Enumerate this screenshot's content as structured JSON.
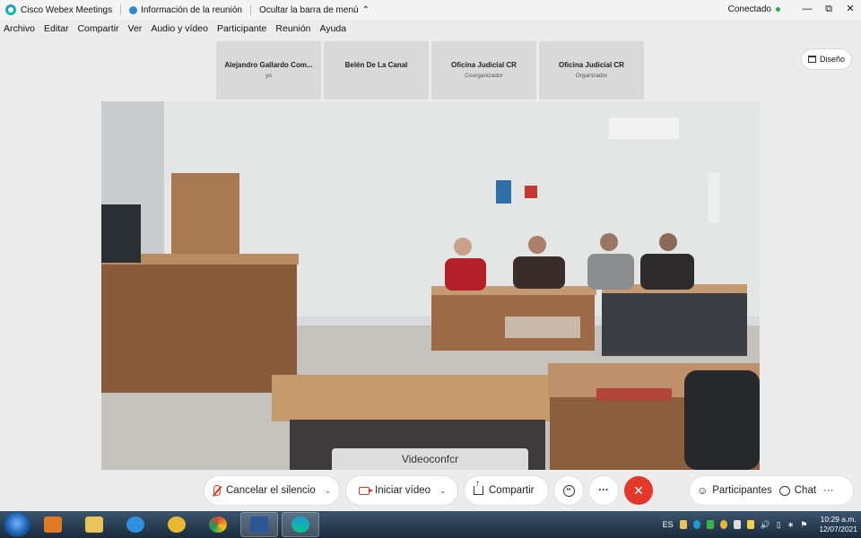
{
  "window": {
    "app_title": "Cisco Webex Meetings",
    "meeting_info": "Información de la reunión",
    "hide_menu": "Ocultar la barra de menú",
    "status": "Conectado",
    "status_color": "#27b04a"
  },
  "menu": [
    "Archivo",
    "Editar",
    "Compartir",
    "Ver",
    "Audio y vídeo",
    "Participante",
    "Reunión",
    "Ayuda"
  ],
  "participants": [
    {
      "name": "Alejandro Gallardo Com...",
      "role": "yo"
    },
    {
      "name": "Belén De La Canal",
      "role": ""
    },
    {
      "name": "Oficina Judicial CR",
      "role": "Coorganizador"
    },
    {
      "name": "Oficina Judicial CR",
      "role": "Organizador"
    }
  ],
  "layout_button": "Diseño",
  "video": {
    "label": "Videoconfcr"
  },
  "controls": {
    "mute": "Cancelar el silencio",
    "video": "Iniciar vídeo",
    "share": "Compartir",
    "participants": "Participantes",
    "chat": "Chat",
    "more": "···",
    "end_color": "#e5382d"
  },
  "taskbar": {
    "language": "ES",
    "time": "10:29 a.m.",
    "date": "12/07/2021",
    "apps": [
      "media-player-icon",
      "file-explorer-icon",
      "internet-explorer-icon",
      "paint-icon",
      "chrome-icon",
      "word-icon",
      "webex-icon"
    ]
  }
}
